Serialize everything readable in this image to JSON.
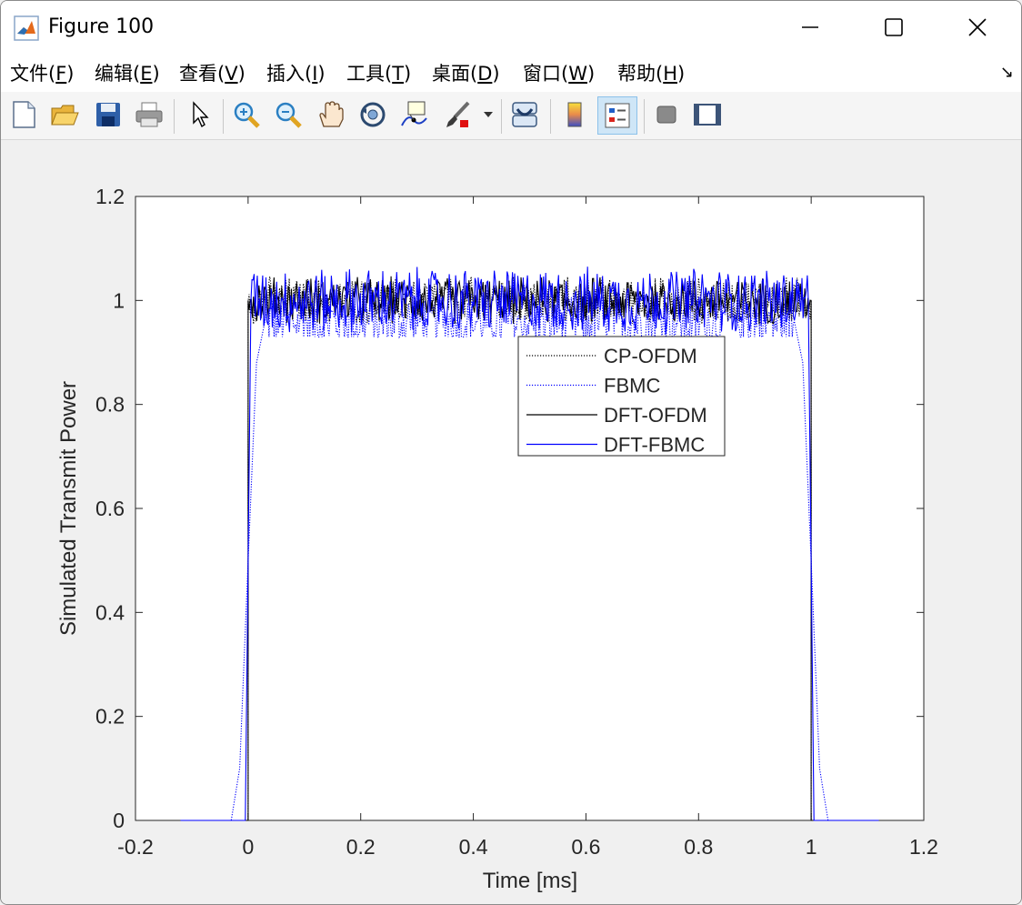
{
  "window": {
    "title": "Figure 100",
    "min_icon": "minimize-icon",
    "max_icon": "maximize-icon",
    "close_icon": "close-icon"
  },
  "menu": [
    {
      "label": "文件(",
      "key": "F",
      "tail": ")"
    },
    {
      "label": "编辑(",
      "key": "E",
      "tail": ")"
    },
    {
      "label": "查看(",
      "key": "V",
      "tail": ")"
    },
    {
      "label": "插入(",
      "key": "I",
      "tail": ")"
    },
    {
      "label": "工具(",
      "key": "T",
      "tail": ")"
    },
    {
      "label": "桌面(",
      "key": "D",
      "tail": ")"
    },
    {
      "label": "窗口(",
      "key": "W",
      "tail": ")"
    },
    {
      "label": "帮助(",
      "key": "H",
      "tail": ")"
    }
  ],
  "toolbar": {
    "icons": [
      "new-figure-icon",
      "open-file-icon",
      "save-icon",
      "print-icon",
      "select-arrow-icon",
      "zoom-in-icon",
      "zoom-out-icon",
      "pan-hand-icon",
      "rotate-3d-icon",
      "data-cursor-icon",
      "brush-icon",
      "link-plot-icon",
      "colorbar-icon",
      "legend-icon",
      "hide-plot-tools-icon",
      "show-plot-tools-icon"
    ]
  },
  "chart_data": {
    "type": "line",
    "title": "",
    "xlabel": "Time [ms]",
    "ylabel": "Simulated Transmit Power",
    "xlim": [
      -0.2,
      1.2
    ],
    "ylim": [
      0,
      1.2
    ],
    "xticks": [
      "-0.2",
      "0",
      "0.2",
      "0.4",
      "0.6",
      "0.8",
      "1",
      "1.2"
    ],
    "yticks": [
      "0",
      "0.2",
      "0.4",
      "0.6",
      "0.8",
      "1",
      "1.2"
    ],
    "grid": false,
    "legend_position": "center-right",
    "series": [
      {
        "name": "CP-OFDM",
        "color": "#000000",
        "style": "dotted",
        "x": [
          -0.12,
          0.0,
          0.0,
          1.0,
          1.0,
          1.12
        ],
        "y": [
          0,
          0,
          1.0,
          1.0,
          0,
          0
        ]
      },
      {
        "name": "FBMC",
        "color": "#0000ff",
        "style": "dotted",
        "x": [
          -0.12,
          -0.03,
          -0.015,
          0.0,
          0.015,
          0.03,
          0.97,
          0.985,
          1.0,
          1.015,
          1.03,
          1.12
        ],
        "y": [
          0,
          0,
          0.1,
          0.5,
          0.88,
          0.96,
          0.96,
          0.88,
          0.5,
          0.1,
          0,
          0
        ]
      },
      {
        "name": "DFT-OFDM",
        "color": "#000000",
        "style": "solid",
        "x": [
          -0.12,
          0.0,
          0.0,
          1.0,
          1.0,
          1.12
        ],
        "y": [
          0,
          0,
          1.0,
          1.0,
          0,
          0
        ]
      },
      {
        "name": "DFT-FBMC",
        "color": "#0000ff",
        "style": "solid",
        "x": [
          -0.12,
          -0.005,
          0.005,
          0.995,
          1.005,
          1.12
        ],
        "y": [
          0,
          0,
          1.0,
          1.0,
          0,
          0
        ]
      }
    ],
    "noise_band": {
      "ymin": 0.95,
      "ymax": 1.06,
      "xstart": 0.0,
      "xend": 1.0
    }
  }
}
